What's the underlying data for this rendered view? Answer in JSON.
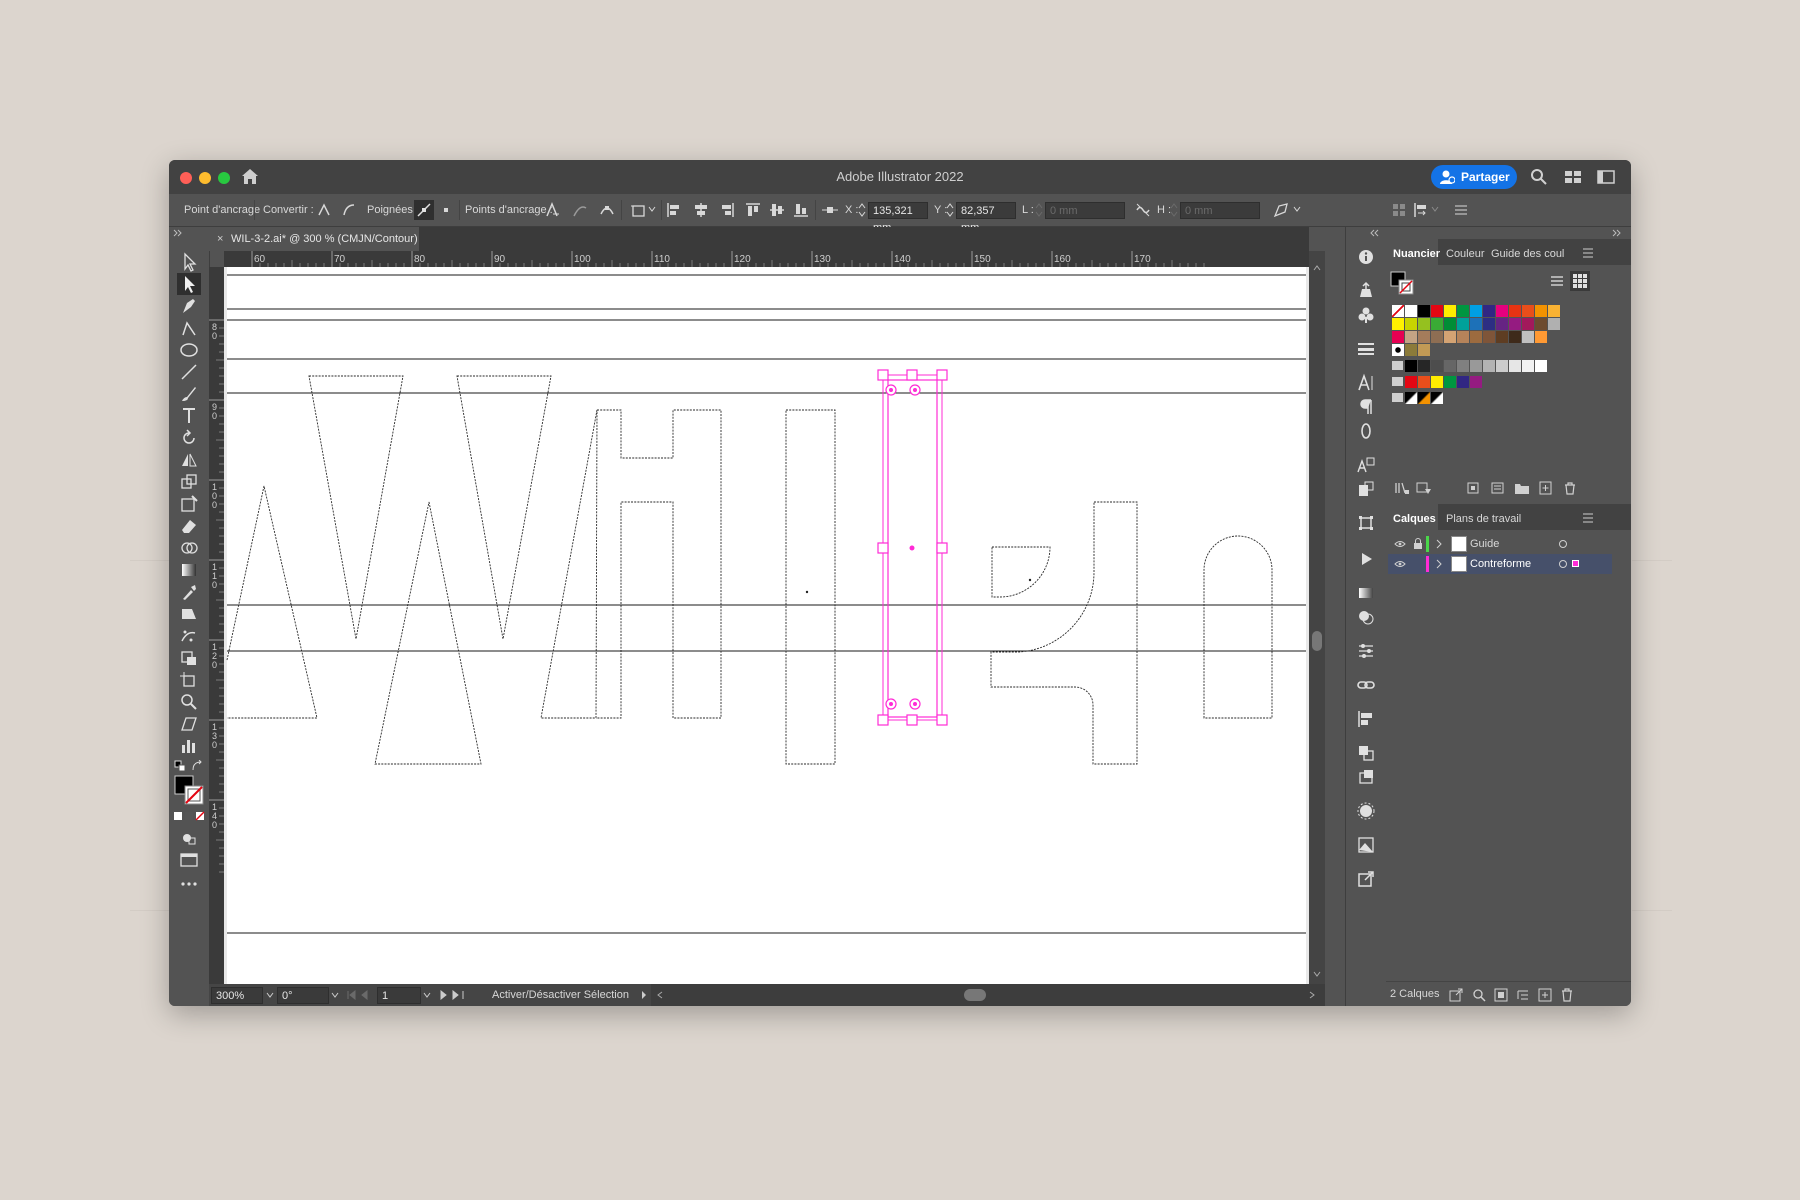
{
  "window": {
    "title": "Adobe Illustrator 2022",
    "share_label": "Partager",
    "colors": {
      "accent": "#1473e6",
      "selection": "#ff2bd6",
      "close": "#ff5f57",
      "minimize": "#febc2e",
      "zoom": "#28c840"
    }
  },
  "control_bar": {
    "anchor_point_label": "Point d'ancrage",
    "convert_label": "Convertir :",
    "handles_label": "Poignées :",
    "anchor_points_label": "Points d'ancrage :",
    "x_label": "X :",
    "x_value": "135,321 mm",
    "y_label": "Y :",
    "y_value": "82,357 mm",
    "l_label": "L :",
    "l_value": "0 mm",
    "h_label": "H :",
    "h_value": "0 mm"
  },
  "document": {
    "tab_title": "WIL-3-2.ai* @ 300 % (CMJN/Contour)"
  },
  "rulers": {
    "horizontal": [
      "60",
      "70",
      "80",
      "90",
      "100",
      "110",
      "120",
      "130",
      "140",
      "150",
      "160",
      "170"
    ],
    "vertical": [
      "80",
      "90",
      "100",
      "110",
      "120",
      "130",
      "140"
    ]
  },
  "status_bar": {
    "zoom": "300%",
    "rotation": "0°",
    "artboard": "1",
    "status_text": "Activer/Désactiver Sélection"
  },
  "swatches_panel": {
    "tabs": [
      "Nuancier",
      "Couleur",
      "Guide des coul"
    ],
    "row1": [
      "#ffffff",
      "#ffffff",
      "#000000",
      "#e30613",
      "#ffed00",
      "#009640",
      "#009fe3",
      "#312783",
      "#e6007e",
      "#e63312",
      "#e94e1b",
      "#f39200",
      "#f9b233"
    ],
    "row2": [
      "#fff200",
      "#c8d400",
      "#95c11f",
      "#3aaa35",
      "#008d36",
      "#00a19a",
      "#1d71b8",
      "#2d2e83",
      "#662483",
      "#951b81",
      "#a2195b",
      "#6d4b2f",
      "#b0b0b0"
    ],
    "row3": [
      "#e50052",
      "#c4a484",
      "#a47c5b",
      "#8e6e53",
      "#d4a373",
      "#b5835a",
      "#9c6b3f",
      "#7f5539",
      "#5e3d22",
      "#3e2a1a",
      "#c0c0c0",
      "#ff9933"
    ],
    "gray_group": [
      "#000000",
      "#262626",
      "#4d4d4d",
      "#666666",
      "#808080",
      "#999999",
      "#b3b3b3",
      "#cccccc",
      "#e6e6e6",
      "#f2f2f2",
      "#ffffff"
    ],
    "color_group": [
      "#e30613",
      "#e94e1b",
      "#ffed00",
      "#009640",
      "#312783",
      "#951b81"
    ]
  },
  "layers_panel": {
    "tabs": [
      "Calques",
      "Plans de travail"
    ],
    "layers": [
      {
        "name": "Guide",
        "color": "#4ad64a"
      },
      {
        "name": "Contreforme",
        "color": "#ff2bd6"
      }
    ],
    "count_label": "2 Calques"
  }
}
